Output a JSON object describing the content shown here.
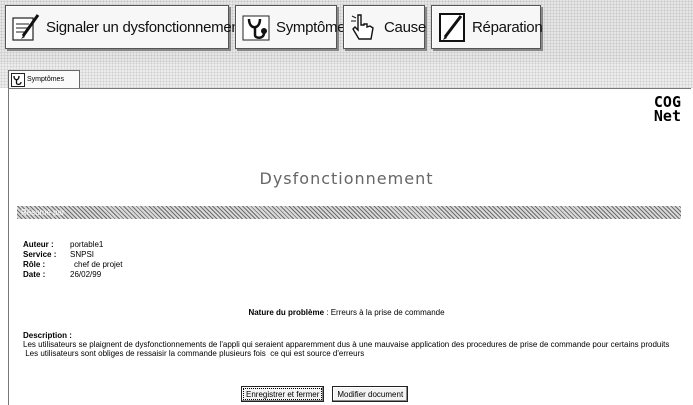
{
  "toolbar": {
    "buttons": [
      {
        "label": "Signaler un dysfonctionnement",
        "icon": "form-pencil-icon"
      },
      {
        "label": "Symptôme",
        "icon": "stethoscope-icon"
      },
      {
        "label": "Cause",
        "icon": "hand-pointer-icon"
      },
      {
        "label": "Réparation",
        "icon": "pencil-notepad-icon"
      }
    ]
  },
  "tab": {
    "label": "Symptômes",
    "icon": "stethoscope-icon"
  },
  "logo": {
    "line1": "COG",
    "line2": "Net"
  },
  "page_title": "Dysfonctionnement",
  "section_bar_label": "Résumé par",
  "meta": {
    "auteur_label": "Auteur :",
    "auteur": "portable1",
    "service_label": "Service :",
    "service": "SNPSI",
    "role_label": "Rôle :",
    "role": "chef de projet",
    "date_label": "Date :",
    "date": "26/02/99"
  },
  "nature": {
    "label": "Nature du problème",
    "value": ": Erreurs à la prise de commande"
  },
  "description": {
    "label": "Description :",
    "lines": [
      "Les utilisateurs se plaignent de dysfonctionnements de l'appli qui seraient apparemment dus à une mauvaise application des procedures de prise de commande pour certains produits",
      " Les utilisateurs sont obliges de ressaisir la commande plusieurs fois  ce qui est source d'erreurs"
    ]
  },
  "actions": {
    "save_close": "Enregistrer et fermer",
    "modify": "Modifier document"
  }
}
